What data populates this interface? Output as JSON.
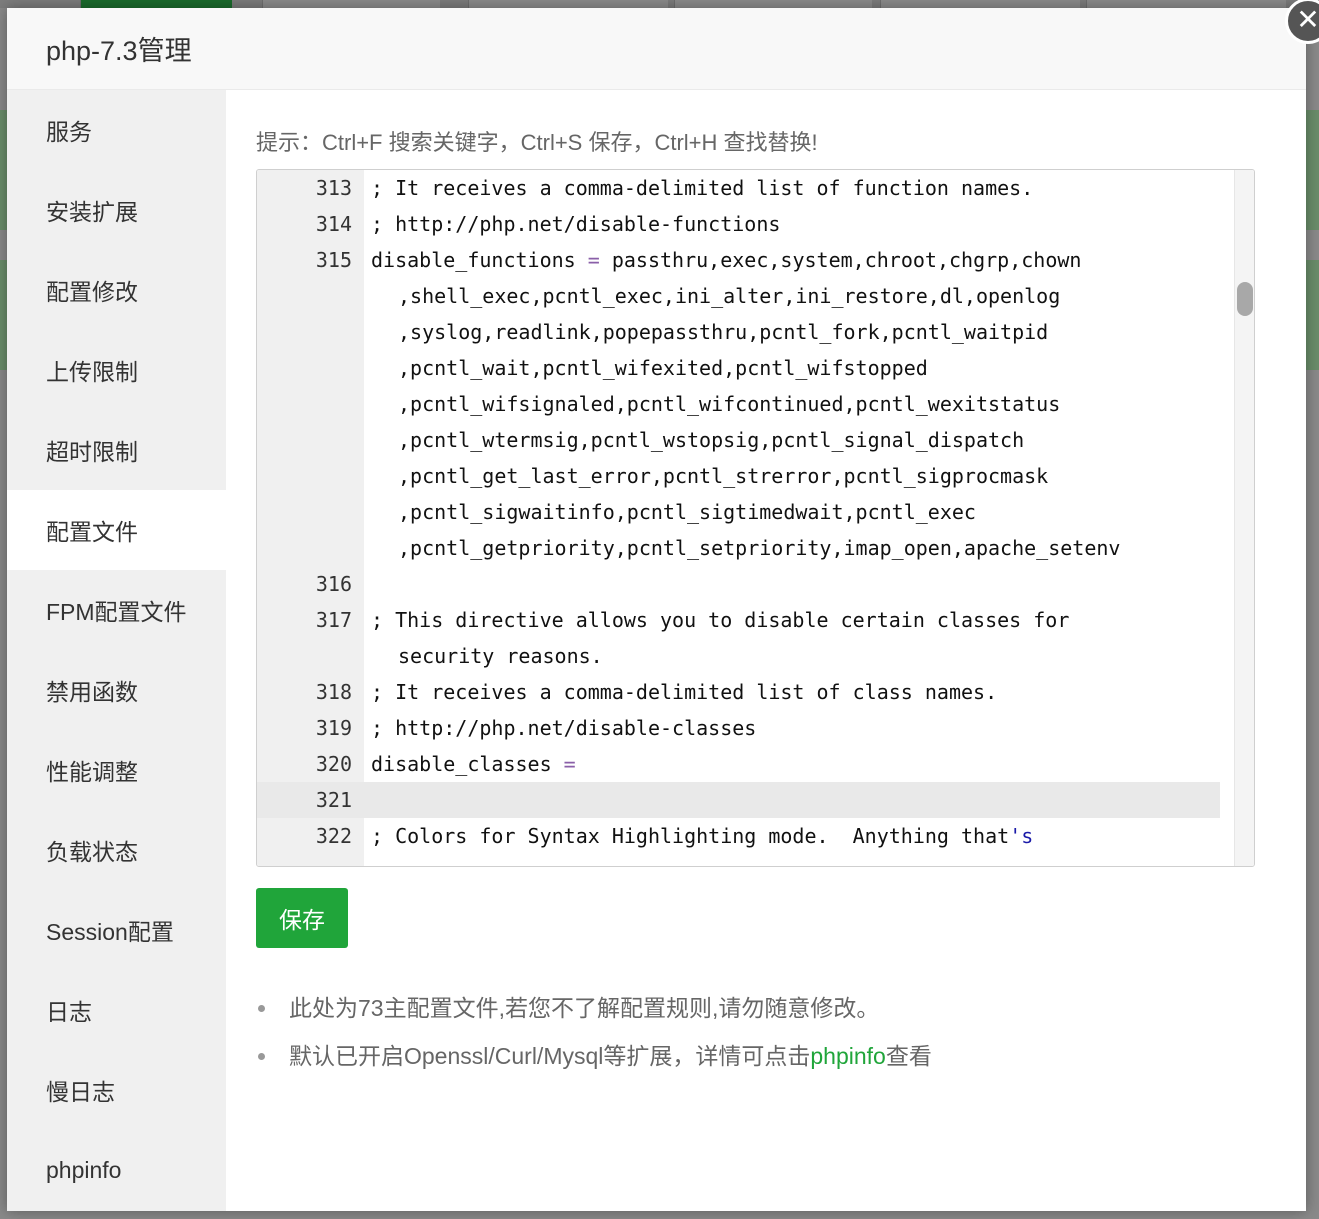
{
  "modal": {
    "title": "php-7.3管理",
    "close_icon": "close-icon"
  },
  "sidebar": {
    "items": [
      {
        "label": "服务"
      },
      {
        "label": "安装扩展"
      },
      {
        "label": "配置修改"
      },
      {
        "label": "上传限制"
      },
      {
        "label": "超时限制"
      },
      {
        "label": "配置文件",
        "active": true
      },
      {
        "label": "FPM配置文件"
      },
      {
        "label": "禁用函数"
      },
      {
        "label": "性能调整"
      },
      {
        "label": "负载状态"
      },
      {
        "label": "Session配置"
      },
      {
        "label": "日志"
      },
      {
        "label": "慢日志"
      },
      {
        "label": "phpinfo"
      }
    ]
  },
  "main": {
    "tip": "提示：Ctrl+F 搜索关键字，Ctrl+S 保存，Ctrl+H 查找替换!",
    "editor": {
      "l313": {
        "num": "313",
        "text": "; It receives a comma-delimited list of function names."
      },
      "l314": {
        "num": "314",
        "text": "; http://php.net/disable-functions"
      },
      "l315": {
        "num": "315",
        "key": "disable_functions",
        "op": "=",
        "value": "passthru,exec,system,chroot,chgrp,chown",
        "wraps": [
          ",shell_exec,pcntl_exec,ini_alter,ini_restore,dl,openlog",
          ",syslog,readlink,popepassthru,pcntl_fork,pcntl_waitpid",
          ",pcntl_wait,pcntl_wifexited,pcntl_wifstopped",
          ",pcntl_wifsignaled,pcntl_wifcontinued,pcntl_wexitstatus",
          ",pcntl_wtermsig,pcntl_wstopsig,pcntl_signal_dispatch",
          ",pcntl_get_last_error,pcntl_strerror,pcntl_sigprocmask",
          ",pcntl_sigwaitinfo,pcntl_sigtimedwait,pcntl_exec",
          ",pcntl_getpriority,pcntl_setpriority,imap_open,apache_setenv"
        ]
      },
      "l316": {
        "num": "316",
        "text": ""
      },
      "l317": {
        "num": "317",
        "text": "; This directive allows you to disable certain classes for",
        "wrap": "security reasons."
      },
      "l318": {
        "num": "318",
        "text": "; It receives a comma-delimited list of class names."
      },
      "l319": {
        "num": "319",
        "text": "; http://php.net/disable-classes"
      },
      "l320": {
        "num": "320",
        "key": "disable_classes",
        "op": "="
      },
      "l321": {
        "num": "321",
        "text": ""
      },
      "l322": {
        "num": "322",
        "text": "; Colors for Syntax Highlighting mode.  Anything that",
        "str": "'s"
      }
    },
    "save_label": "保存",
    "notes": {
      "n1": "此处为73主配置文件,若您不了解配置规则,请勿随意修改。",
      "n2_prefix": "默认已开启Openssl/Curl/Mysql等扩展，详情可点击",
      "n2_link": "phpinfo",
      "n2_suffix": "查看"
    }
  },
  "colors": {
    "accent": "#20a53a",
    "keyword": "#1a1aa8",
    "operator": "#8a5fa8"
  }
}
